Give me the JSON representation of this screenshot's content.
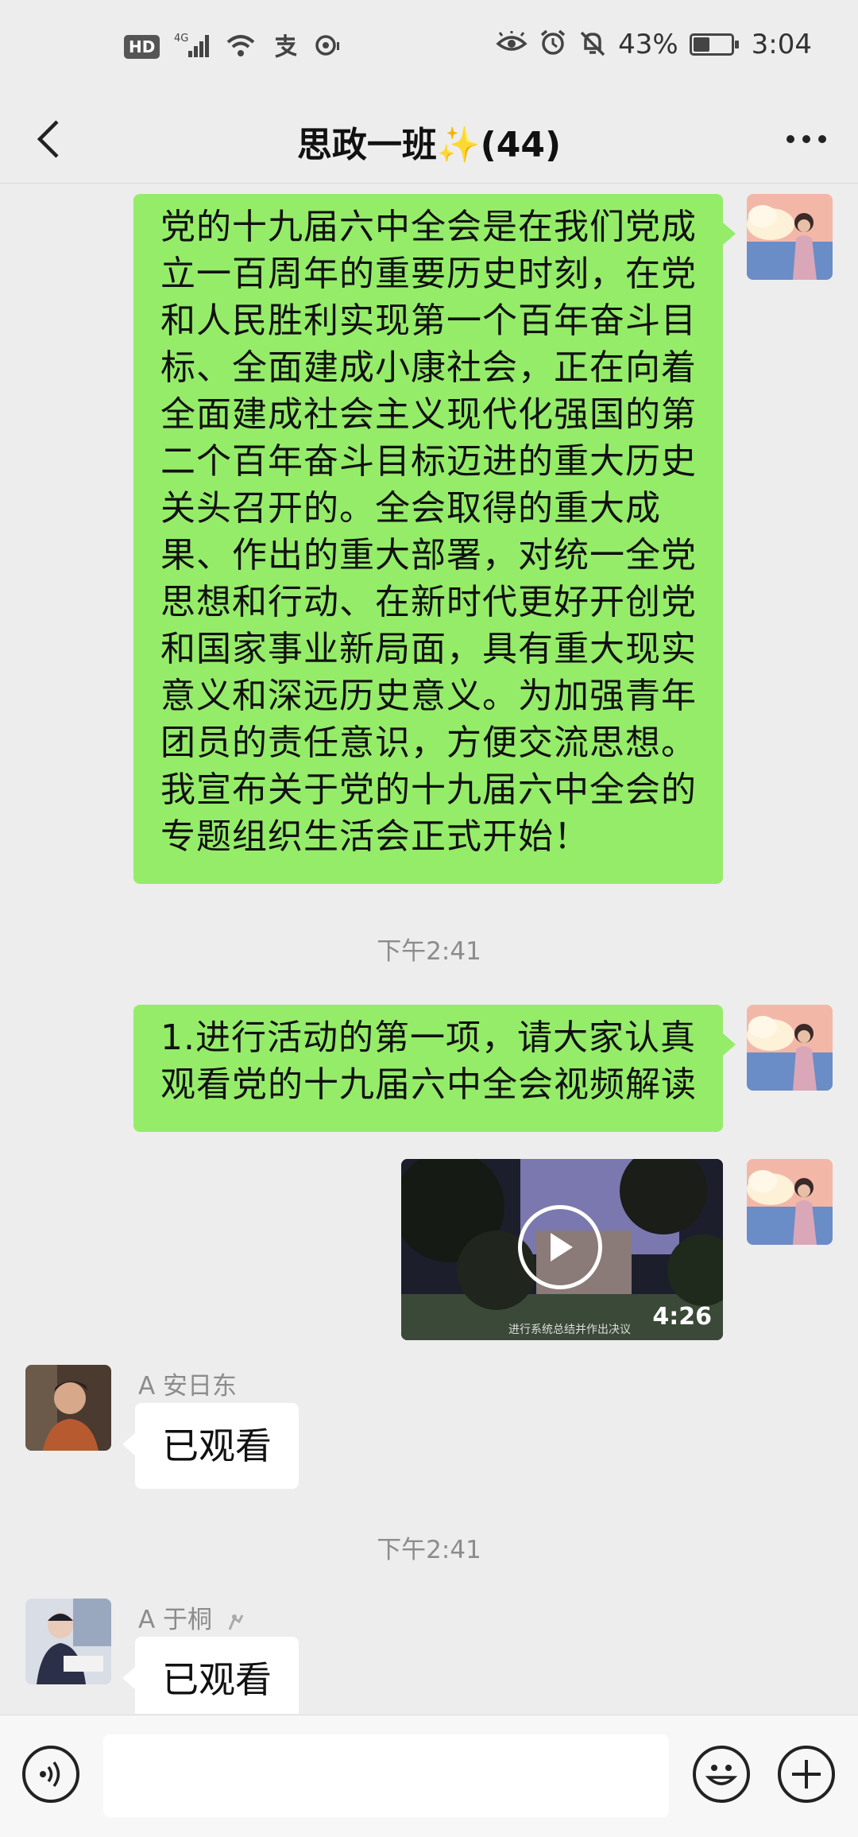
{
  "status_bar": {
    "hd": "HD",
    "network": "4G",
    "battery_percent": "43%",
    "battery_level": 0.43,
    "time": "3:04",
    "icons_left": [
      "signal-icon",
      "wifi-icon",
      "alipay-icon",
      "location-icon"
    ],
    "icons_right": [
      "eye-icon",
      "alarm-icon",
      "mute-bell-icon",
      "battery-icon"
    ]
  },
  "nav": {
    "title": "思政一班✨(44)"
  },
  "messages": {
    "m1": {
      "lines": [
        "党的十九届六中全会是在我们党成",
        "立一百周年的重要历史时刻，在党",
        "和人民胜利实现第一个百年奋斗目",
        "标、全面建成小康社会，正在向着",
        "全面建成社会主义现代化强国的第",
        "二个百年奋斗目标迈进的重大历史",
        "关头召开的。全会取得的重大成",
        "果、作出的重大部署，对统一全党",
        "思想和行动、在新时代更好开创党",
        "和国家事业新局面，具有重大现实",
        "意义和深远历史意义。为加强青年",
        "团员的责任意识，方便交流思想。",
        "我宣布关于党的十九届六中全会的",
        "专题组织生活会正式开始！"
      ]
    },
    "ts1": "下午2:41",
    "m2": {
      "lines": [
        "1.进行活动的第一项，请大家认真",
        "观看党的十九届六中全会视频解读"
      ]
    },
    "video": {
      "duration": "4:26",
      "caption": "进行系统总结并作出决议"
    },
    "m3": {
      "sender": "A 安日东",
      "text": "已观看"
    },
    "ts2": "下午2:41",
    "m4": {
      "sender": "A 于桐",
      "text": "已观看"
    }
  },
  "input_bar": {
    "placeholder": ""
  }
}
